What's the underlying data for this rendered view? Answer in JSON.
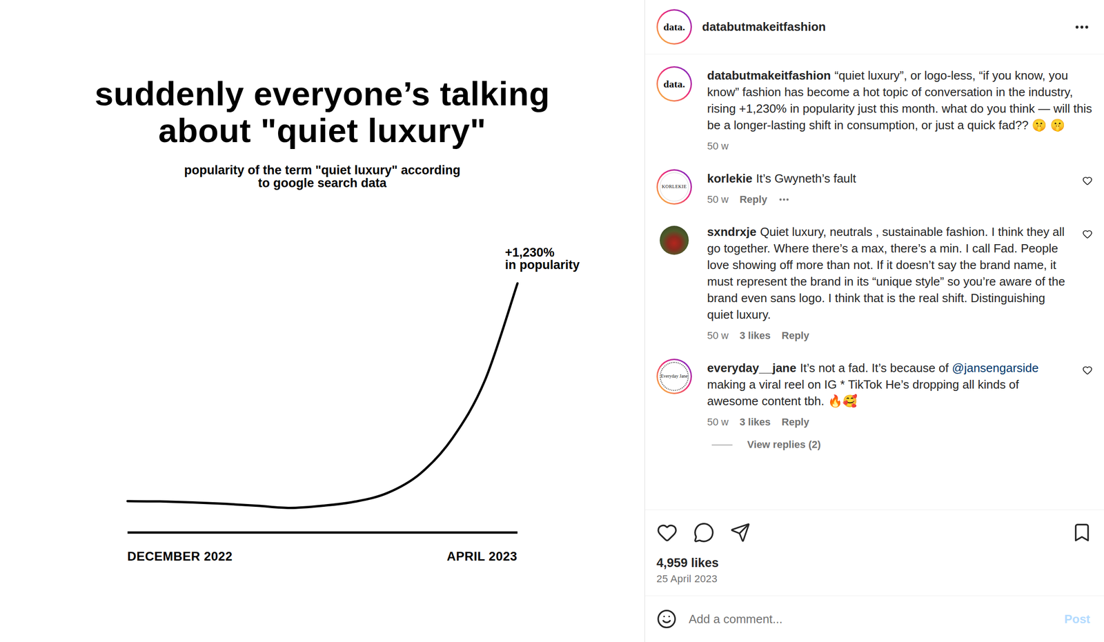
{
  "post_image": {
    "title_lines": [
      "suddenly everyone’s talking",
      "about \"quiet luxury\""
    ],
    "subtitle_lines": [
      "popularity of the term \"quiet luxury\" according",
      "to google search data"
    ],
    "annotation": [
      "+1,230%",
      "in popularity"
    ],
    "x_labels": [
      "DECEMBER 2022",
      "APRIL 2023"
    ],
    "series": [
      {
        "name": "quiet luxury",
        "values": [
          10.1,
          10.0,
          9.6,
          9.0,
          8.2,
          7.3,
          8.2,
          9.9,
          13.5,
          21.4,
          36.1,
          60.0,
          100
        ]
      }
    ]
  },
  "post_header": {
    "username": "databutmakeitfashion",
    "avatar_text": "data."
  },
  "caption": {
    "username": "databutmakeitfashion",
    "avatar_text": "data.",
    "text": "“quiet luxury”, or logo-less, “if you know, you know” fashion has become a hot topic of conversation in the industry, rising +1,230% in popularity just this month. what do you think — will this be a longer-lasting shift in consumption, or just a quick fad?? 🤫 🤫",
    "time": "50 w"
  },
  "comments": [
    {
      "username": "korlekie",
      "avatar": {
        "kind": "logo",
        "text": "KORLEKIE",
        "story_ring": true
      },
      "segments": [
        {
          "kind": "plain",
          "text": "It’s Gwyneth’s fault"
        }
      ],
      "time": "50 w",
      "likes": "",
      "reply": "Reply",
      "has_more": true,
      "liked": false,
      "view_replies": ""
    },
    {
      "username": "sxndrxje",
      "avatar": {
        "kind": "photo",
        "text": "",
        "story_ring": false
      },
      "segments": [
        {
          "kind": "plain",
          "text": "Quiet luxury, neutrals , sustainable fashion. I think they all go together. Where there’s a max, there’s a min. I call Fad. People love showing off more than not. If it doesn’t say the brand name, it must represent the brand in its “unique style” so you’re aware of the brand even sans logo. I think that is the real shift. Distinguishing quiet luxury."
        }
      ],
      "time": "50 w",
      "likes": "3 likes",
      "reply": "Reply",
      "has_more": false,
      "liked": false,
      "view_replies": ""
    },
    {
      "username": "everyday__jane",
      "avatar": {
        "kind": "badge",
        "text": "Everyday Jane",
        "story_ring": true
      },
      "segments": [
        {
          "kind": "plain",
          "text": "It’s not a fad. It’s because of "
        },
        {
          "kind": "mention",
          "text": "@jansengarside"
        },
        {
          "kind": "plain",
          "text": " making a viral reel on IG * TikTok He’s dropping all kinds of awesome content tbh. 🔥🥰"
        }
      ],
      "time": "50 w",
      "likes": "3 likes",
      "reply": "Reply",
      "has_more": false,
      "liked": false,
      "view_replies": "View replies (2)"
    }
  ],
  "actions": {
    "liked": false,
    "saved": false,
    "likes": "4,959 likes",
    "date": "25 April 2023"
  },
  "composer": {
    "placeholder": "Add a comment...",
    "button": "Post",
    "button_disabled": true
  }
}
